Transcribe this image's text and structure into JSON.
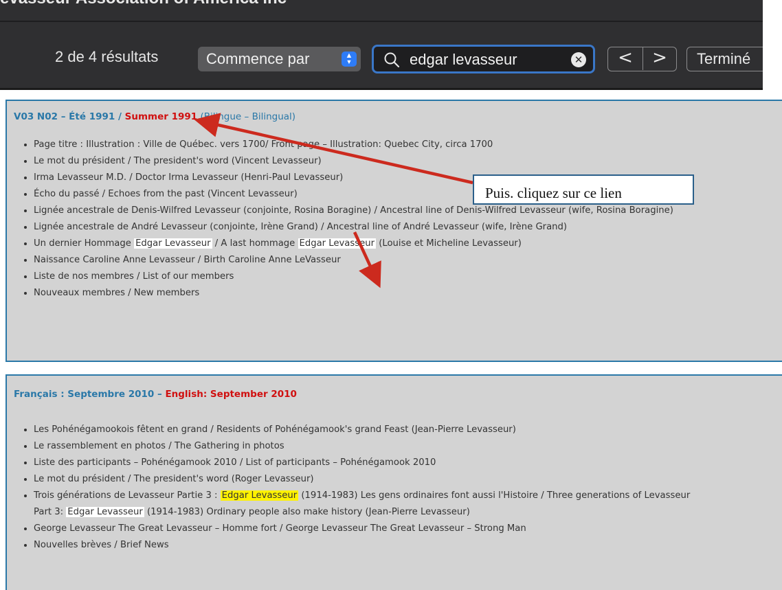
{
  "toolbar": {
    "window_title": "evasseur Association of America inc",
    "result_count": "2 de 4 résultats",
    "mode_select": "Commence par",
    "search_value": "edgar levasseur",
    "prev_label": "<",
    "next_label": ">",
    "done_label": "Terminé"
  },
  "callout": "Puis. cliquez sur ce lien",
  "issue1": {
    "title_fr": "V03 N02 – Été 1991 / ",
    "title_en": "Summer 1991",
    "title_note": " (Bilingue – Bilingual)",
    "items": [
      "Page titre : Illustration : Ville de Québec. vers 1700/ Front page – Illustration: Quebec City, circa 1700",
      "Le mot du président / The president's word (Vincent Levasseur)",
      "Irma Levasseur M.D. / Doctor Irma Levasseur (Henri-Paul Levasseur)",
      "Écho du passé / Echoes from the past (Vincent Levasseur)",
      "Lignée ancestrale de Denis-Wilfred Levasseur (conjointe, Rosina Boragine)  / Ancestral line of Denis-Wilfred Levasseur (wife, Rosina Boragine)",
      "Lignée ancestrale de André Levasseur (conjointe, Irène Grand) / Ancestral line of André Levasseur (wife, Irène Grand)"
    ],
    "tribute": {
      "a": "Un dernier Hommage ",
      "name1": "Edgar Levasseur",
      "b": "  / A last hommage ",
      "name2": "Edgar Levasseur",
      "c": "  (Louise et Micheline Levasseur)"
    },
    "items_after": [
      "Naissance Caroline Anne Levasseur / Birth Caroline Anne LeVasseur",
      "Liste de nos membres  / List of our members",
      "Nouveaux membres / New members"
    ]
  },
  "issue2": {
    "title_fr": "Français : Septembre 2010",
    "title_sep": "  –  ",
    "title_en": "English: September 2010",
    "items": [
      "Les Pohénégamookois fêtent en grand / Residents of Pohénégamook's grand Feast (Jean-Pierre Levasseur)",
      "Le rassemblement en photos / The Gathering in photos",
      "Liste des participants – Pohénégamook 2010 / List of participants – Pohénégamook 2010",
      "Le mot du président / The president's word (Roger Levasseur)"
    ],
    "generations": {
      "a": "Trois générations de Levasseur Partie 3 : ",
      "name1": "Edgar Levasseur",
      "b": " (1914-1983) Les gens ordinaires font aussi l'Histoire / Three generations of Levasseur",
      "c": "Part 3: ",
      "name2": "Edgar Levasseur",
      "d": " (1914-1983) Ordinary people also make history (Jean-Pierre Levasseur)"
    },
    "items_after": [
      "George Levasseur The Great Levasseur – Homme fort / George Levasseur The Great Levasseur – Strong Man",
      "Nouvelles brèves / Brief News"
    ]
  },
  "colors": {
    "accent_blue": "#2a78a8",
    "english_red": "#d01010",
    "arrow_red": "#cc2a1e",
    "highlight_yellow": "#fff200",
    "toolbar_bg": "#2f2f31",
    "search_focus": "#3a77c8"
  }
}
